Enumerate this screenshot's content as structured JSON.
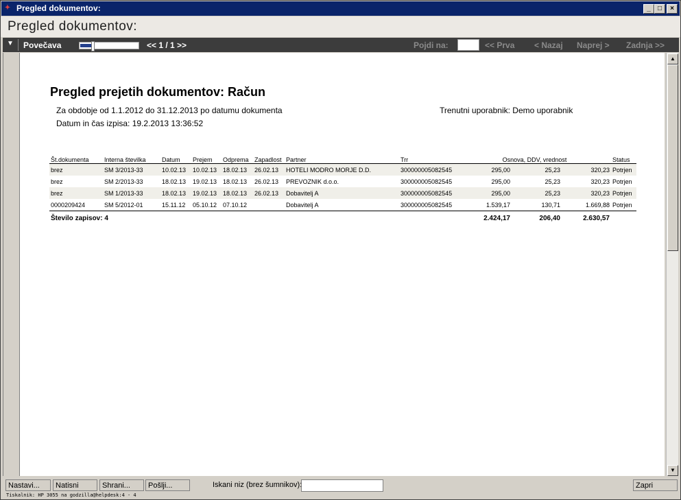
{
  "window": {
    "title": "Pregled dokumentov:",
    "heading": "Pregled dokumentov:"
  },
  "toolbar": {
    "zoom_label": "Povečava",
    "zoom_level": 0.2,
    "page_nav": "<< 1 / 1 >>",
    "goto_label": "Pojdi na:",
    "first": "<< Prva",
    "back": "< Nazaj",
    "forward": "Naprej >",
    "last": "Zadnja >>"
  },
  "report": {
    "title": "Pregled prejetih dokumentov: Račun",
    "period": "Za obdobje od 1.1.2012 do 31.12.2013 po datumu dokumenta",
    "user": "Trenutni uporabnik: Demo uporabnik",
    "printed": "Datum in čas izpisa: 19.2.2013 13:36:52",
    "columns": {
      "doc": "Št.dokumenta",
      "internal": "Interna številka",
      "date": "Datum",
      "received": "Prejem",
      "shipped": "Odprema",
      "due": "Zapadlost",
      "partner": "Partner",
      "trr": "Trr",
      "amounts": "Osnova, DDV, vrednost",
      "status": "Status"
    },
    "rows": [
      {
        "doc": "brez",
        "internal": "SM 3/2013-33",
        "date": "10.02.13",
        "received": "10.02.13",
        "shipped": "18.02.13",
        "due": "26.02.13",
        "partner": "HOTELI MODRO MORJE D.D.",
        "trr": "300000005082545",
        "base": "295,00",
        "vat": "25,23",
        "value": "320,23",
        "status": "Potrjen"
      },
      {
        "doc": "brez",
        "internal": "SM 2/2013-33",
        "date": "18.02.13",
        "received": "19.02.13",
        "shipped": "18.02.13",
        "due": "26.02.13",
        "partner": "PREVOZNIK d.o.o.",
        "trr": "300000005082545",
        "base": "295,00",
        "vat": "25,23",
        "value": "320,23",
        "status": "Potrjen"
      },
      {
        "doc": "brez",
        "internal": "SM 1/2013-33",
        "date": "18.02.13",
        "received": "19.02.13",
        "shipped": "18.02.13",
        "due": "26.02.13",
        "partner": "Dobavitelj A",
        "trr": "300000005082545",
        "base": "295,00",
        "vat": "25,23",
        "value": "320,23",
        "status": "Potrjen"
      },
      {
        "doc": "0000209424",
        "internal": "SM 5/2012-01",
        "date": "15.11.12",
        "received": "05.10.12",
        "shipped": "07.10.12",
        "due": "",
        "partner": "Dobavitelj A",
        "trr": "300000005082545",
        "base": "1.539,17",
        "vat": "130,71",
        "value": "1.669,88",
        "status": "Potrjen"
      }
    ],
    "totals": {
      "label": "Število zapisov: 4",
      "base": "2.424,17",
      "vat": "206,40",
      "value": "2.630,57"
    }
  },
  "bottom": {
    "setup": "Nastavi...",
    "print": "Natisni",
    "save": "Shrani...",
    "send": "Pošlji...",
    "search_label": "Iskani niz (brez šumnikov):",
    "search_value": "",
    "close": "Zapri",
    "status": "Tiskalnik: HP 3055 na godzilla@helpdesk:4 - 4"
  }
}
